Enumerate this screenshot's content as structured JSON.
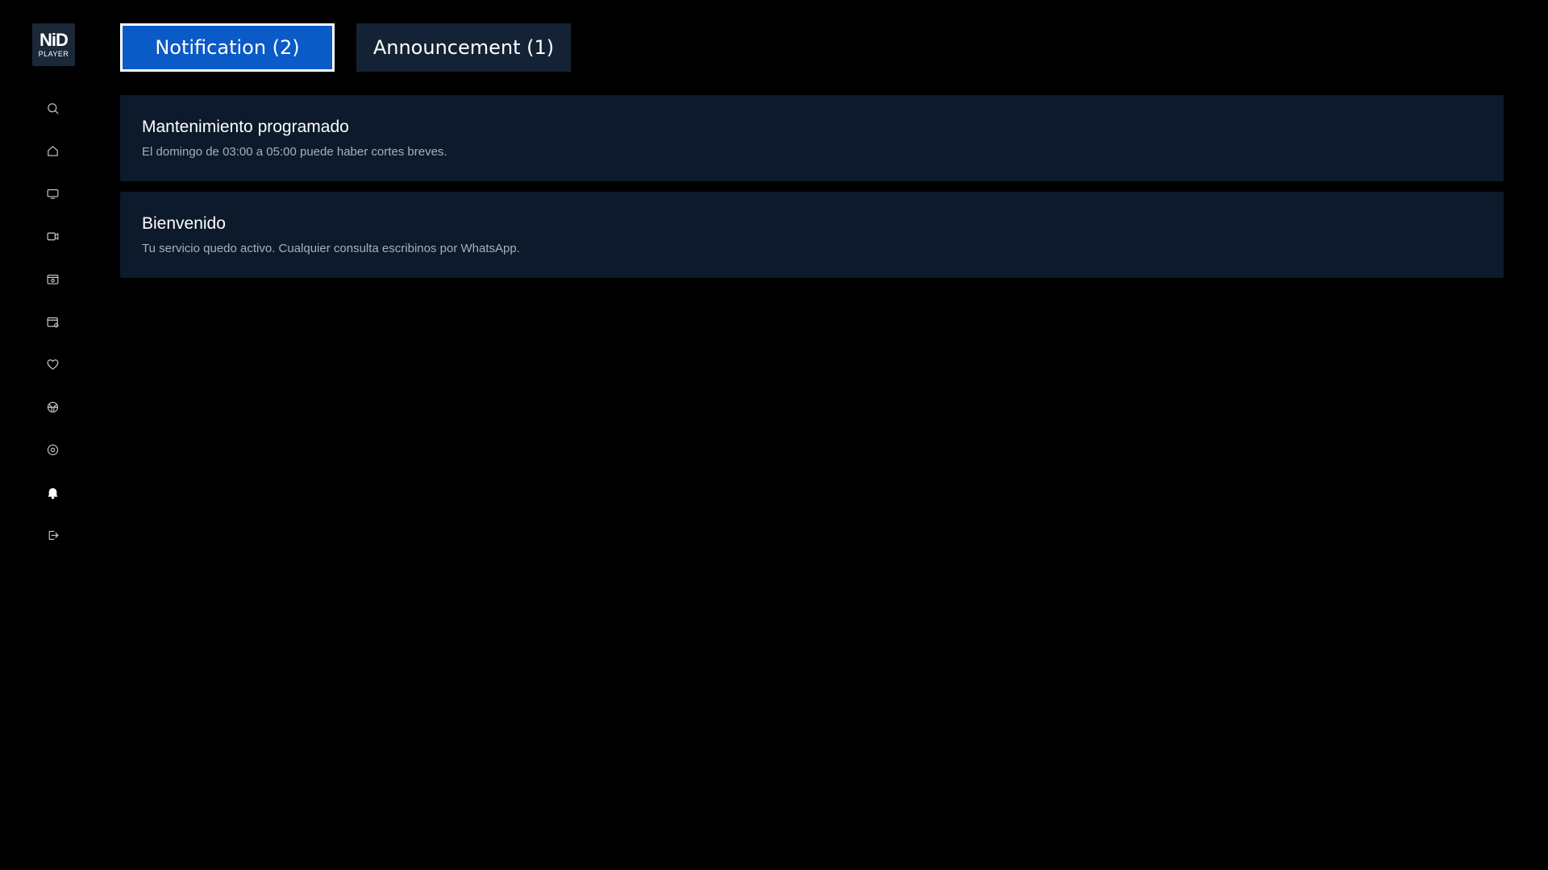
{
  "brand": {
    "logo_main": "NiD",
    "logo_sub": "PLAYER"
  },
  "sidebar": {
    "items": [
      {
        "icon": "search-icon"
      },
      {
        "icon": "home-icon"
      },
      {
        "icon": "tv-icon"
      },
      {
        "icon": "video-camera-icon"
      },
      {
        "icon": "series-icon"
      },
      {
        "icon": "calendar-icon"
      },
      {
        "icon": "heart-icon"
      },
      {
        "icon": "sports-ball-icon"
      },
      {
        "icon": "settings-icon"
      },
      {
        "icon": "bell-icon",
        "active": true
      },
      {
        "icon": "logout-icon"
      }
    ]
  },
  "tabs": {
    "notification_label": "Notification (2)",
    "announcement_label": "Announcement (1)"
  },
  "notifications": [
    {
      "title": "Mantenimiento programado",
      "body": "El domingo de 03:00 a 05:00 puede haber cortes breves."
    },
    {
      "title": "Bienvenido",
      "body": "Tu servicio quedo activo. Cualquier consulta escribinos por WhatsApp."
    }
  ],
  "colors": {
    "background": "#000000",
    "accent": "#0a5ac8",
    "card": "#0c1a2b",
    "tab_inactive": "#142235"
  }
}
